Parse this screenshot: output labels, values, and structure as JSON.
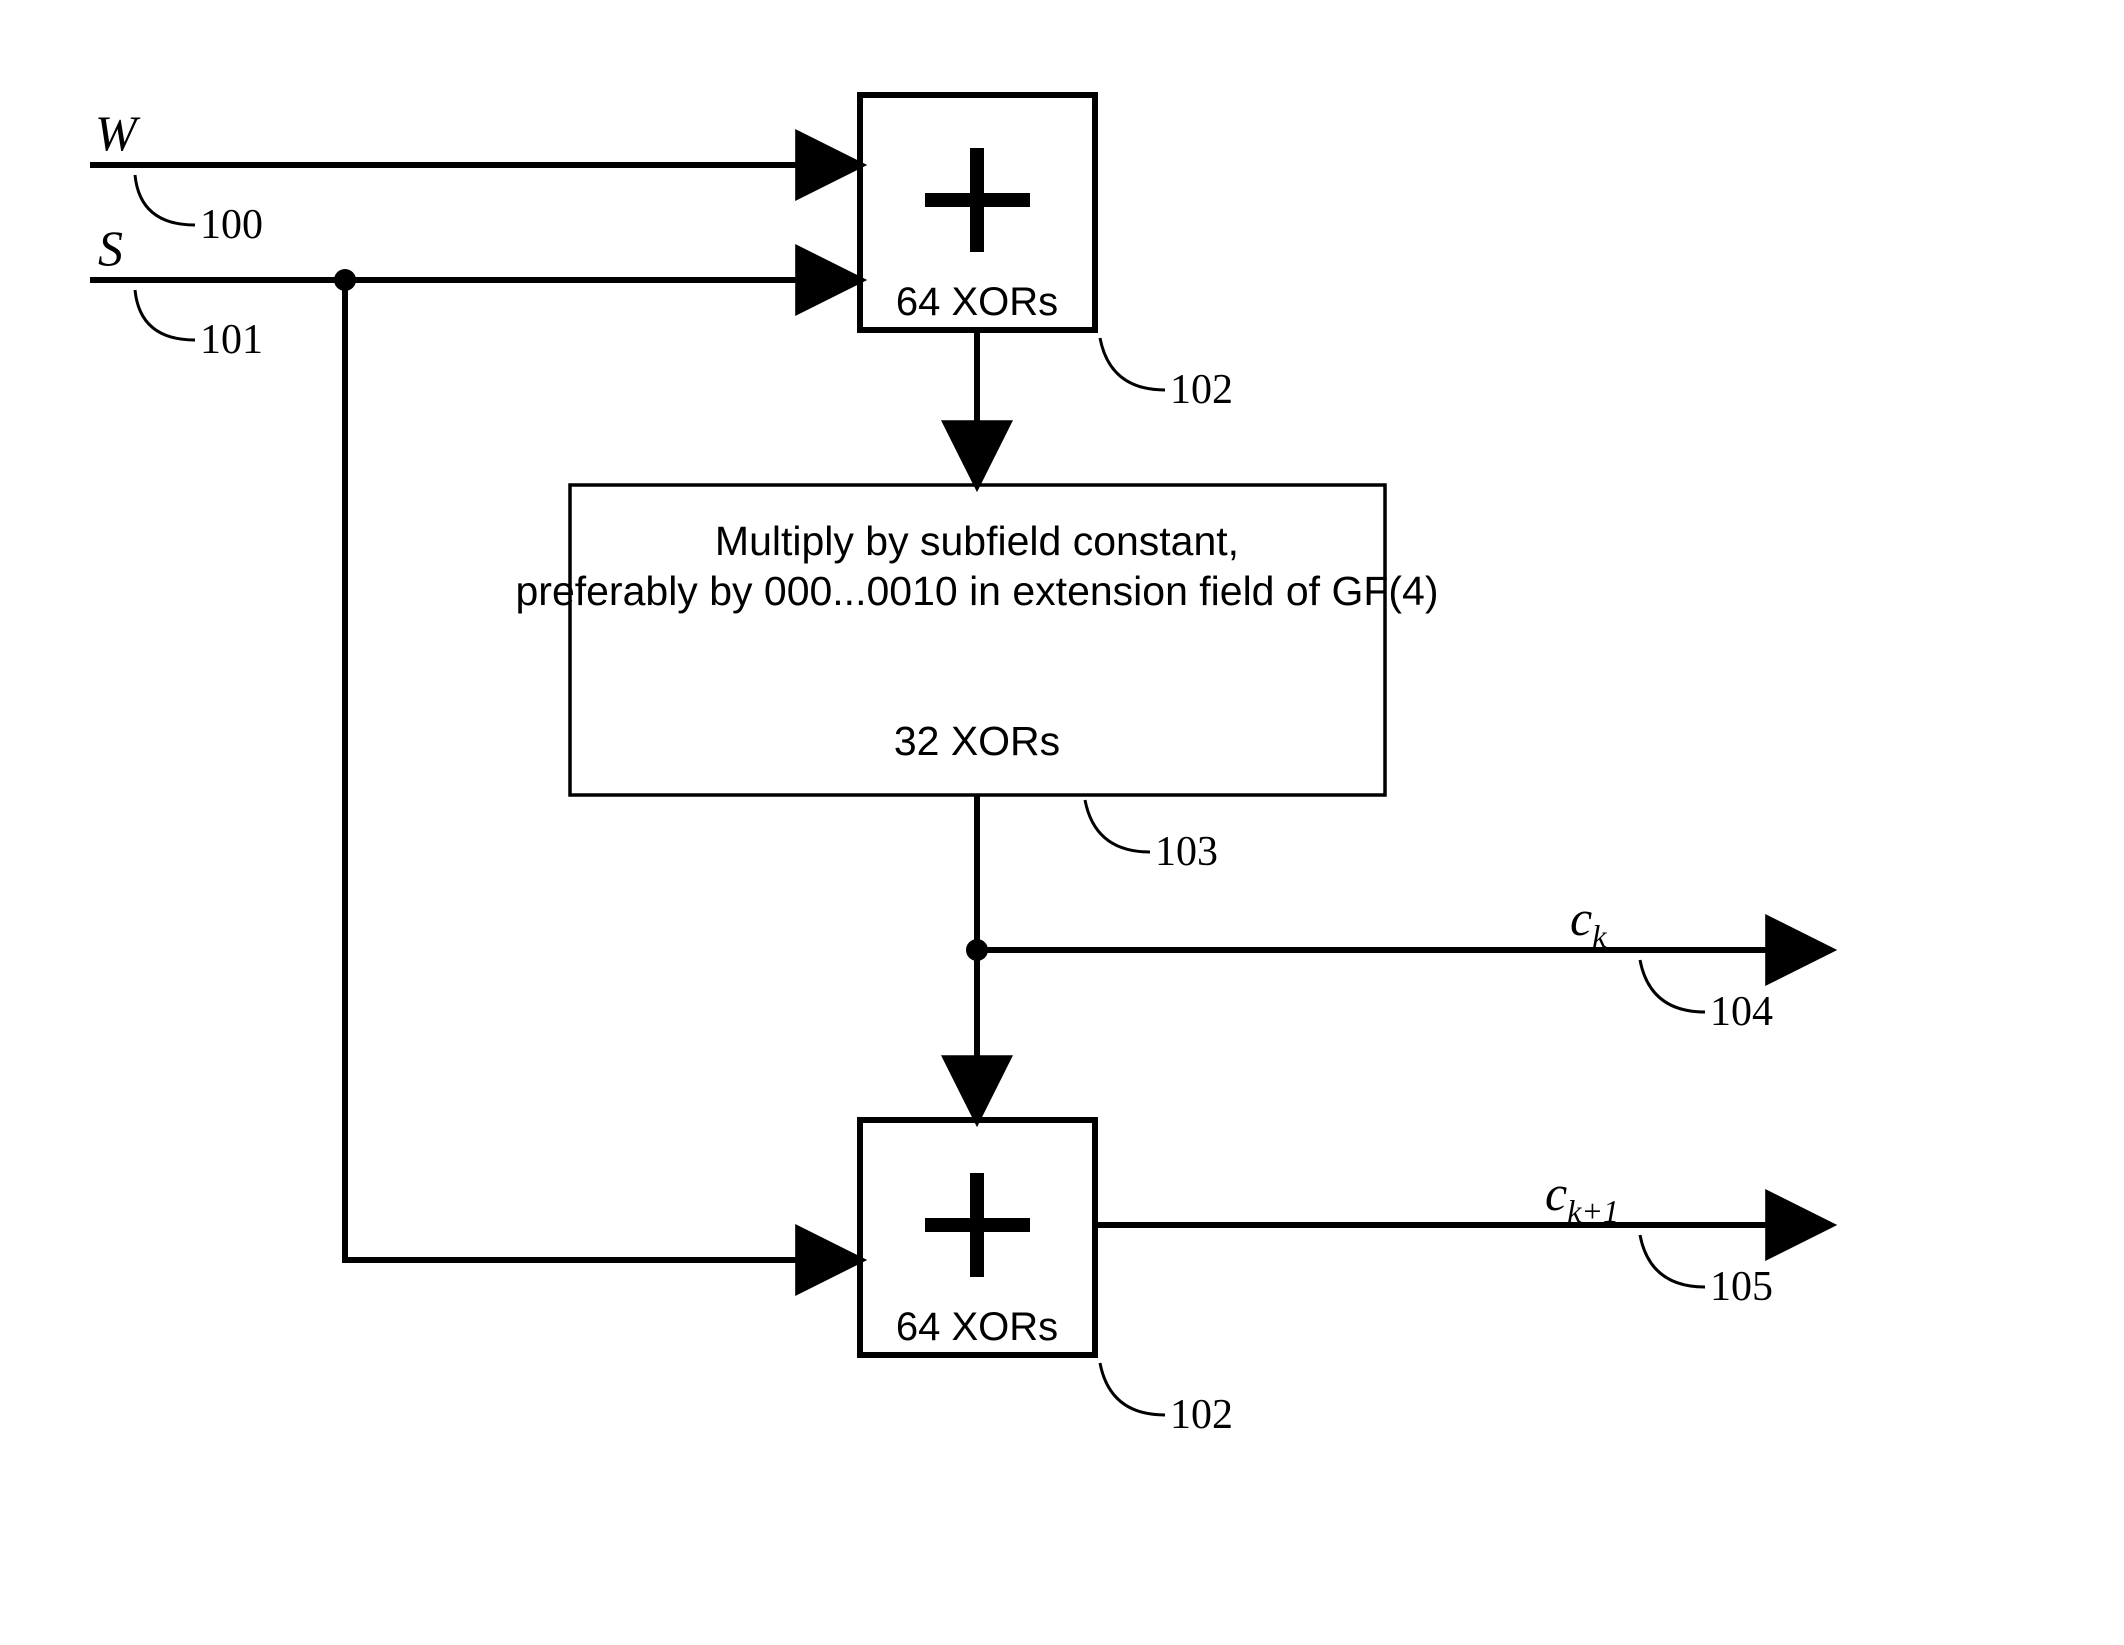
{
  "inputs": {
    "w": "W",
    "s": "S"
  },
  "refs": {
    "r100": "100",
    "r101": "101",
    "r102_top": "102",
    "r102_bottom": "102",
    "r103": "103",
    "r104": "104",
    "r105": "105"
  },
  "xor_block": {
    "top_label": "64 XORs",
    "bottom_label": "64 XORs"
  },
  "mult_block": {
    "line1": "Multiply by subfield constant,",
    "line2": "preferably by 000...0010 in extension field of GF(4)",
    "line3": "32 XORs"
  },
  "outputs": {
    "ck_base": "c",
    "ck_sub": "k",
    "ck1_base": "c",
    "ck1_sub": "k+1"
  }
}
